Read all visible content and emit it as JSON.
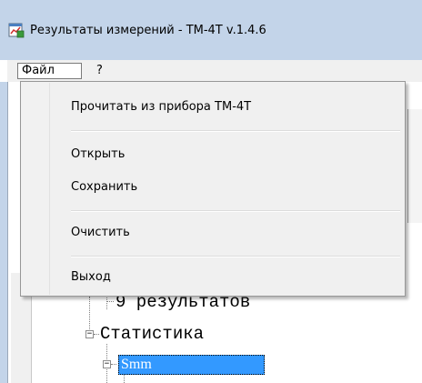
{
  "window": {
    "title": "Результаты измерений - ТМ-4Т v.1.4.6",
    "app_icon": "chart-window-icon"
  },
  "menubar": {
    "file_label": "Файл",
    "help_label": "?"
  },
  "file_menu": {
    "items": [
      {
        "label": "Прочитать из прибора ТМ-4Т"
      },
      {
        "label": "Открыть"
      },
      {
        "label": "Сохранить"
      },
      {
        "label": "Очистить"
      },
      {
        "label": "Выход"
      }
    ]
  },
  "tree": {
    "results_label": "9 результатов",
    "statistics_label": "Статистика",
    "smm_label": "Smm",
    "expander_symbol": "−"
  },
  "colors": {
    "title_bar": "#c3d4e9",
    "selection": "#3399ff"
  }
}
